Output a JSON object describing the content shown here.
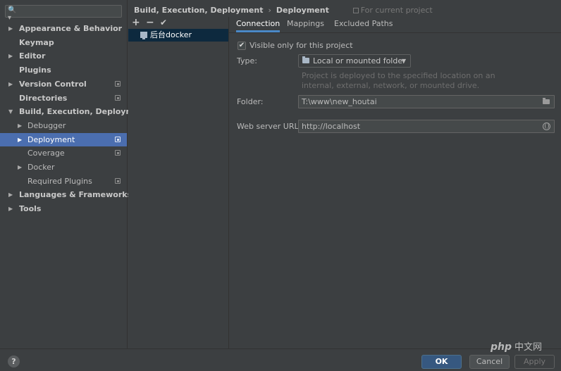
{
  "search": {
    "value": "",
    "icon": "search-icon"
  },
  "tree": [
    {
      "label": "Appearance & Behavior",
      "bold": true,
      "arrow": "▶",
      "indent": 0,
      "project": false
    },
    {
      "label": "Keymap",
      "bold": true,
      "arrow": "",
      "indent": 0,
      "project": false
    },
    {
      "label": "Editor",
      "bold": true,
      "arrow": "▶",
      "indent": 0,
      "project": false
    },
    {
      "label": "Plugins",
      "bold": true,
      "arrow": "",
      "indent": 0,
      "project": false
    },
    {
      "label": "Version Control",
      "bold": true,
      "arrow": "▶",
      "indent": 0,
      "project": true
    },
    {
      "label": "Directories",
      "bold": true,
      "arrow": "",
      "indent": 0,
      "project": true
    },
    {
      "label": "Build, Execution, Deployment",
      "bold": true,
      "arrow": "▼",
      "indent": 0,
      "project": false
    },
    {
      "label": "Debugger",
      "bold": false,
      "arrow": "▶",
      "indent": 1,
      "project": false
    },
    {
      "label": "Deployment",
      "bold": false,
      "arrow": "▶",
      "indent": 1,
      "project": true,
      "selected": true
    },
    {
      "label": "Coverage",
      "bold": false,
      "arrow": "",
      "indent": 1,
      "project": true
    },
    {
      "label": "Docker",
      "bold": false,
      "arrow": "▶",
      "indent": 1,
      "project": false
    },
    {
      "label": "Required Plugins",
      "bold": false,
      "arrow": "",
      "indent": 1,
      "project": true
    },
    {
      "label": "Languages & Frameworks",
      "bold": true,
      "arrow": "▶",
      "indent": 0,
      "project": false
    },
    {
      "label": "Tools",
      "bold": true,
      "arrow": "▶",
      "indent": 0,
      "project": false
    }
  ],
  "breadcrumb": {
    "parent": "Build, Execution, Deployment",
    "separator": "›",
    "current": "Deployment",
    "hint": "For current project"
  },
  "toolbar": {
    "add": "+",
    "remove": "−",
    "apply": "✔"
  },
  "servers": [
    {
      "label": "后台docker"
    }
  ],
  "tabs": [
    {
      "label": "Connection",
      "active": true
    },
    {
      "label": "Mappings",
      "active": false
    },
    {
      "label": "Excluded Paths",
      "active": false
    }
  ],
  "connection": {
    "visible_only_label": "Visible only for this project",
    "visible_only_checked": true,
    "type_label": "Type:",
    "type_value": "Local or mounted folder",
    "type_description": "Project is deployed to the specified location on an internal, external, network, or mounted drive.",
    "folder_label": "Folder:",
    "folder_value": "T:\\www\\new_houtai",
    "web_url_label": "Web server URL:",
    "web_url_value": "http://localhost"
  },
  "buttons": {
    "help": "?",
    "ok": "OK",
    "cancel": "Cancel",
    "apply": "Apply"
  },
  "watermark": {
    "latin": "php",
    "cn": "中文网"
  }
}
